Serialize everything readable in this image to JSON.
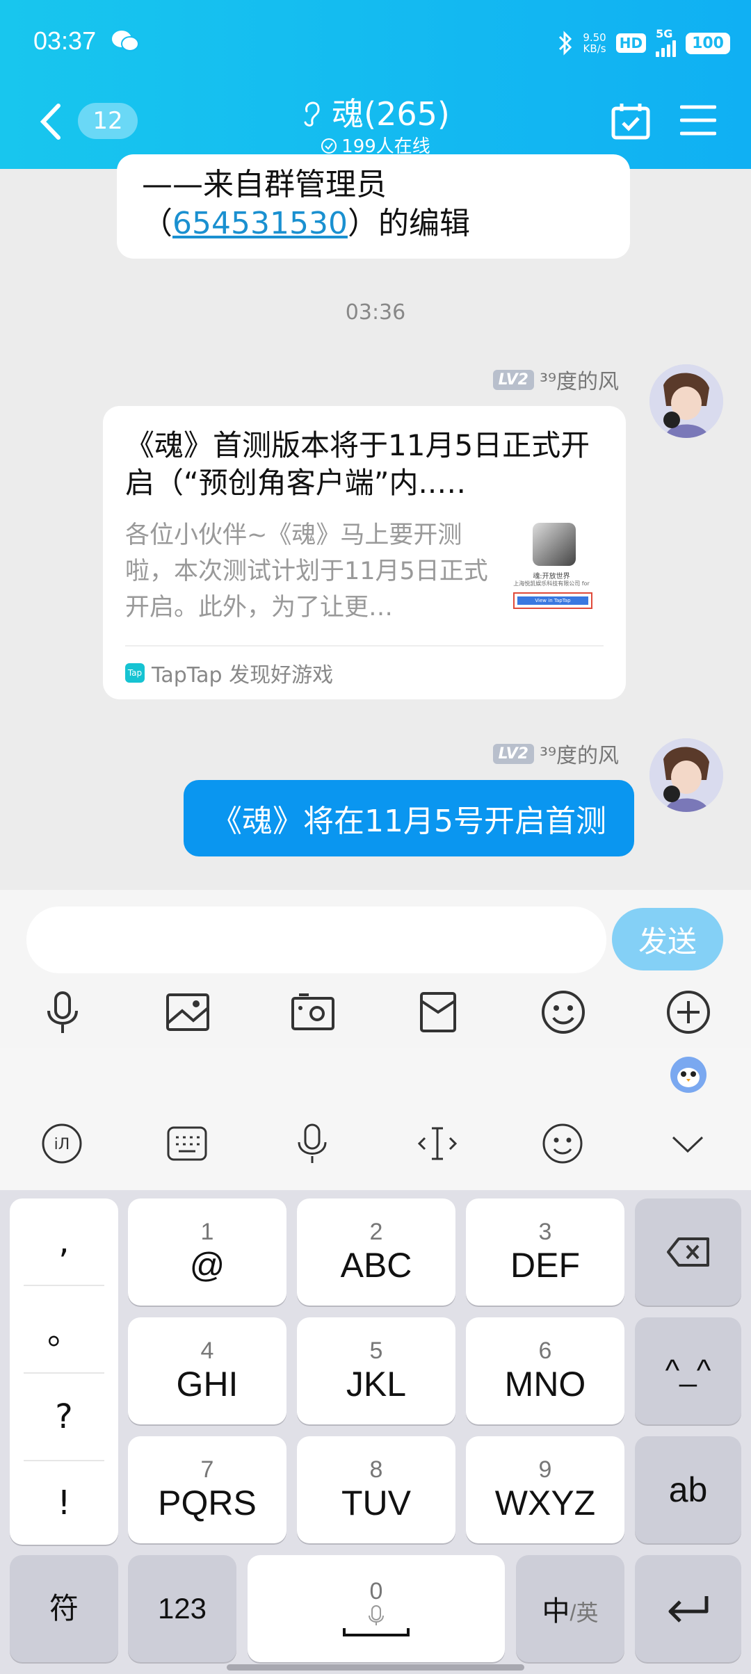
{
  "status": {
    "time": "03:37",
    "net_speed_top": "9.50",
    "net_speed_bottom": "KB/s",
    "hd": "HD",
    "network": "5G",
    "battery": "100"
  },
  "header": {
    "back_count": "12",
    "title": "魂(265)",
    "online": "199人在线"
  },
  "chat": {
    "notice_line1": "——来自群管理员",
    "notice_open": "（",
    "notice_id": "654531530",
    "notice_close": "）的编辑",
    "timestamp": "03:36",
    "messages": [
      {
        "level": "LV2",
        "nickname": "³⁹度的风",
        "card_title": "《魂》首测版本将于11月5日正式开启（“预创角客户端”内..…",
        "card_desc": "各位小伙伴~《魂》马上要开测啦，本次测试计划于11月5日正式开启。此外，为了让更…",
        "thumb_text": "魂:开放世界",
        "thumb_sub": "上海悦凯娱乐科技有限公司 for",
        "thumb_btn": "View in TapTap",
        "source_logo": "Tap",
        "source": "TapTap 发现好游戏"
      },
      {
        "level": "LV2",
        "nickname": "³⁹度的风",
        "text": "《魂》将在11月5号开启首测"
      }
    ]
  },
  "input": {
    "placeholder": "",
    "send_label": "发送"
  },
  "keyboard": {
    "punct": [
      ",",
      "。",
      "?",
      "!"
    ],
    "keys": [
      {
        "num": "1",
        "letters": "@"
      },
      {
        "num": "2",
        "letters": "ABC"
      },
      {
        "num": "3",
        "letters": "DEF"
      },
      {
        "num": "4",
        "letters": "GHI"
      },
      {
        "num": "5",
        "letters": "JKL"
      },
      {
        "num": "6",
        "letters": "MNO"
      },
      {
        "num": "7",
        "letters": "PQRS"
      },
      {
        "num": "8",
        "letters": "TUV"
      },
      {
        "num": "9",
        "letters": "WXYZ"
      }
    ],
    "emoticon_key": "^_^",
    "ab_key": "ab",
    "symbol_key": "符",
    "num_key": "123",
    "space_num": "0",
    "lang_main": "中",
    "lang_sep": "/英"
  },
  "colors": {
    "header": "#14bcf0",
    "send": "#84d0f6",
    "bubble": "#0a96f0"
  }
}
